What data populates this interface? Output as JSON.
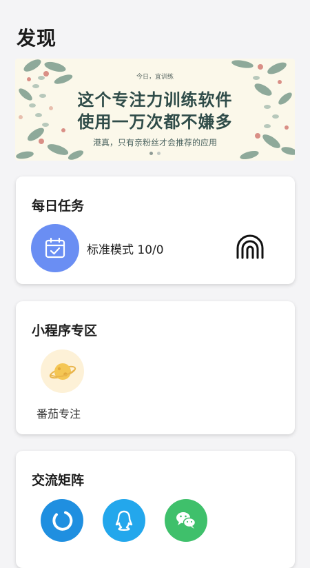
{
  "page": {
    "title": "发现"
  },
  "banner": {
    "kicker": "今日，宜训练",
    "line1": "这个专注力训练软件",
    "line2": "使用一万次都不嫌多",
    "subtitle": "港真，只有亲粉丝才会推荐的应用",
    "slides": 2,
    "active_slide": 1
  },
  "daily_task": {
    "title": "每日任务",
    "mode_label": "标准模式 10/0",
    "icon": "calendar-check-icon",
    "action_icon": "fingerprint-icon"
  },
  "mini_programs": {
    "title": "小程序专区",
    "items": [
      {
        "label": "番茄专注",
        "icon": "planet-icon"
      }
    ]
  },
  "community": {
    "title": "交流矩阵",
    "items": [
      {
        "icon": "weibo-icon",
        "color": "#1f8fe0"
      },
      {
        "icon": "qq-icon",
        "color": "#23a7ec"
      },
      {
        "icon": "wechat-icon",
        "color": "#3fc06b"
      }
    ]
  },
  "colors": {
    "background": "#f4f4f6",
    "task_icon_bg": "#6a8ef3",
    "mini_icon_bg": "#fdf1d7"
  }
}
